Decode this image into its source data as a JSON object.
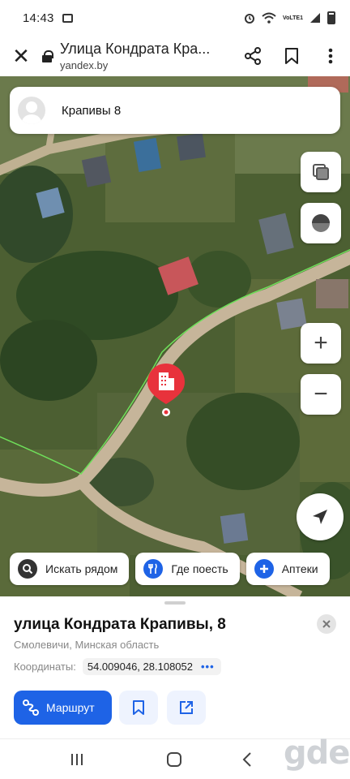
{
  "status_bar": {
    "time": "14:43",
    "network": "VoLTE1",
    "network_sub": "LTE1"
  },
  "browser": {
    "close_icon": "close-icon",
    "page_title": "Улица Кондрата Кра...",
    "url": "yandex.by",
    "share_icon": "share-icon",
    "bookmark_icon": "bookmark-icon",
    "menu_icon": "more-vert-icon"
  },
  "search": {
    "query": "Крапивы 8"
  },
  "map_controls": {
    "layers_icon": "layers-icon",
    "compass_icon": "compass-icon",
    "zoom_in_label": "+",
    "zoom_out_label": "−",
    "location_icon": "navigation-arrow-icon"
  },
  "chips": [
    {
      "label": "Искать рядом",
      "icon": "search-icon",
      "color": "#333333"
    },
    {
      "label": "Где поесть",
      "icon": "food-icon",
      "color": "#1e63e6"
    },
    {
      "label": "Аптеки",
      "icon": "pharmacy-icon",
      "color": "#1e63e6"
    }
  ],
  "place": {
    "address": "улица Кондрата Крапивы, 8",
    "region": "Смолевичи, Минская область",
    "coords_label": "Координаты:",
    "coords_value": "54.009046, 28.108052",
    "coords_more": "•••",
    "route_label": "Маршрут"
  },
  "watermark": "gde",
  "colors": {
    "accent": "#1e63e6",
    "pin": "#e8323c"
  }
}
